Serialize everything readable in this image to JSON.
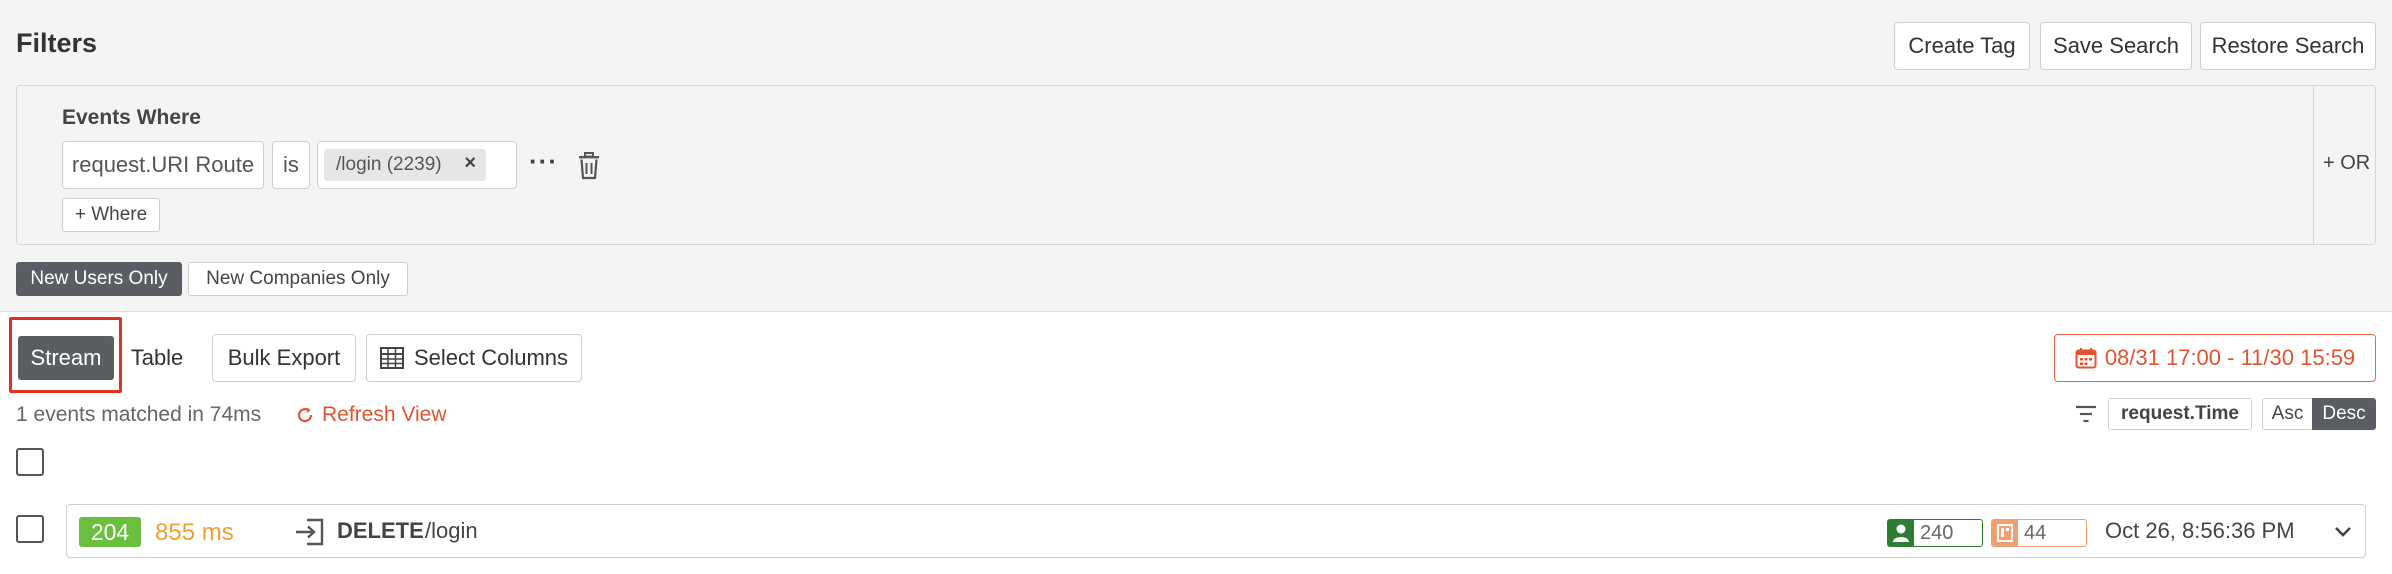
{
  "filters": {
    "title": "Filters",
    "actions": {
      "create_tag": "Create Tag",
      "save_search": "Save Search",
      "restore_search": "Restore Search"
    },
    "events_where_label": "Events Where",
    "condition": {
      "field": "request.URI Route",
      "operator": "is",
      "value": "/login (2239)",
      "remove_symbol": "×",
      "more_symbol": "···"
    },
    "add_where": "+ Where",
    "add_or": "+ OR",
    "toggles": {
      "new_users": "New Users Only",
      "new_companies": "New Companies Only"
    }
  },
  "views": {
    "stream": "Stream",
    "table": "Table",
    "bulk_export": "Bulk Export",
    "select_columns": "Select Columns",
    "active": "Stream"
  },
  "date_range": "08/31 17:00 - 11/30 15:59",
  "results": {
    "summary": "1 events matched in 74ms",
    "refresh": "Refresh View"
  },
  "sort": {
    "field": "request.Time",
    "asc": "Asc",
    "desc": "Desc",
    "selected": "Desc"
  },
  "events": [
    {
      "status": "204",
      "duration": "855 ms",
      "method": "DELETE",
      "route": "/login",
      "user_count": "240",
      "company_count": "44",
      "timestamp": "Oct 26, 8:56:36 PM"
    }
  ],
  "colors": {
    "accent": "#e2542f",
    "status_ok": "#6abf3e",
    "duration": "#f0a030",
    "active_toggle": "#5a5e63",
    "highlight": "#e0301e",
    "user_metric": "#2e7d32",
    "company_metric": "#f0a070"
  },
  "icons": [
    "calendar-icon",
    "refresh-icon",
    "trash-icon",
    "table-grid-icon",
    "filter-sort-icon",
    "login-arrow-icon",
    "user-icon",
    "company-icon",
    "chevron-down-icon"
  ]
}
